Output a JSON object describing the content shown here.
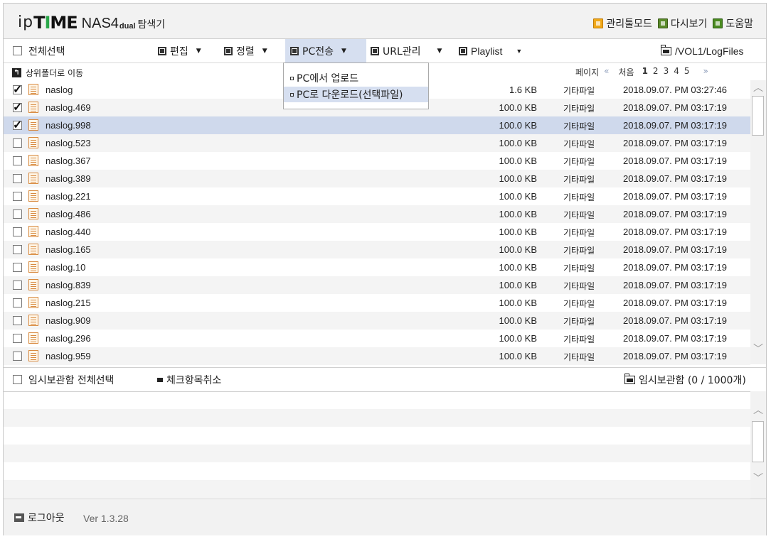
{
  "header": {
    "logo_ip": "ip",
    "logo_time_a": "T",
    "logo_time_b": "I",
    "logo_time_c": "ME",
    "logo_nas": "NAS4",
    "logo_dual": "dual",
    "logo_explorer": "탐색기",
    "links": [
      {
        "label": "관리툴모드",
        "icon": "admin-tool-icon"
      },
      {
        "label": "다시보기",
        "icon": "refresh-icon"
      },
      {
        "label": "도움말",
        "icon": "help-icon"
      }
    ]
  },
  "toolbar": {
    "select_all": "전체선택",
    "edit": "편집",
    "sort": "정렬",
    "pc_transfer": "PC전송",
    "url_manage": "URL관리",
    "playlist": "Playlist",
    "path": "/VOL1/LogFiles"
  },
  "dropdown": {
    "items": [
      "PC에서 업로드",
      "PC로 다운로드(선택파일)"
    ]
  },
  "subbar": {
    "go_up": "상위폴더로 이동",
    "page_label": "페이지",
    "prev": "«",
    "first": "처음",
    "pages": [
      "1",
      "2",
      "3",
      "4",
      "5"
    ],
    "next": "»"
  },
  "files": [
    {
      "name": "naslog",
      "size": "1.6 KB",
      "type": "기타파일",
      "date": "2018.09.07. PM 03:27:46",
      "checked": true,
      "selected": false
    },
    {
      "name": "naslog.469",
      "size": "100.0 KB",
      "type": "기타파일",
      "date": "2018.09.07. PM 03:17:19",
      "checked": true,
      "selected": false
    },
    {
      "name": "naslog.998",
      "size": "100.0 KB",
      "type": "기타파일",
      "date": "2018.09.07. PM 03:17:19",
      "checked": true,
      "selected": true
    },
    {
      "name": "naslog.523",
      "size": "100.0 KB",
      "type": "기타파일",
      "date": "2018.09.07. PM 03:17:19",
      "checked": false,
      "selected": false
    },
    {
      "name": "naslog.367",
      "size": "100.0 KB",
      "type": "기타파일",
      "date": "2018.09.07. PM 03:17:19",
      "checked": false,
      "selected": false
    },
    {
      "name": "naslog.389",
      "size": "100.0 KB",
      "type": "기타파일",
      "date": "2018.09.07. PM 03:17:19",
      "checked": false,
      "selected": false
    },
    {
      "name": "naslog.221",
      "size": "100.0 KB",
      "type": "기타파일",
      "date": "2018.09.07. PM 03:17:19",
      "checked": false,
      "selected": false
    },
    {
      "name": "naslog.486",
      "size": "100.0 KB",
      "type": "기타파일",
      "date": "2018.09.07. PM 03:17:19",
      "checked": false,
      "selected": false
    },
    {
      "name": "naslog.440",
      "size": "100.0 KB",
      "type": "기타파일",
      "date": "2018.09.07. PM 03:17:19",
      "checked": false,
      "selected": false
    },
    {
      "name": "naslog.165",
      "size": "100.0 KB",
      "type": "기타파일",
      "date": "2018.09.07. PM 03:17:19",
      "checked": false,
      "selected": false
    },
    {
      "name": "naslog.10",
      "size": "100.0 KB",
      "type": "기타파일",
      "date": "2018.09.07. PM 03:17:19",
      "checked": false,
      "selected": false
    },
    {
      "name": "naslog.839",
      "size": "100.0 KB",
      "type": "기타파일",
      "date": "2018.09.07. PM 03:17:19",
      "checked": false,
      "selected": false
    },
    {
      "name": "naslog.215",
      "size": "100.0 KB",
      "type": "기타파일",
      "date": "2018.09.07. PM 03:17:19",
      "checked": false,
      "selected": false
    },
    {
      "name": "naslog.909",
      "size": "100.0 KB",
      "type": "기타파일",
      "date": "2018.09.07. PM 03:17:19",
      "checked": false,
      "selected": false
    },
    {
      "name": "naslog.296",
      "size": "100.0 KB",
      "type": "기타파일",
      "date": "2018.09.07. PM 03:17:19",
      "checked": false,
      "selected": false
    },
    {
      "name": "naslog.959",
      "size": "100.0 KB",
      "type": "기타파일",
      "date": "2018.09.07. PM 03:17:19",
      "checked": false,
      "selected": false
    }
  ],
  "tempbar": {
    "select_all": "임시보관함 전체선택",
    "uncheck": "체크항목취소",
    "storage_label": "임시보관함 (0 / 1000개)"
  },
  "footer": {
    "logout": "로그아웃",
    "version": "Ver 1.3.28"
  }
}
